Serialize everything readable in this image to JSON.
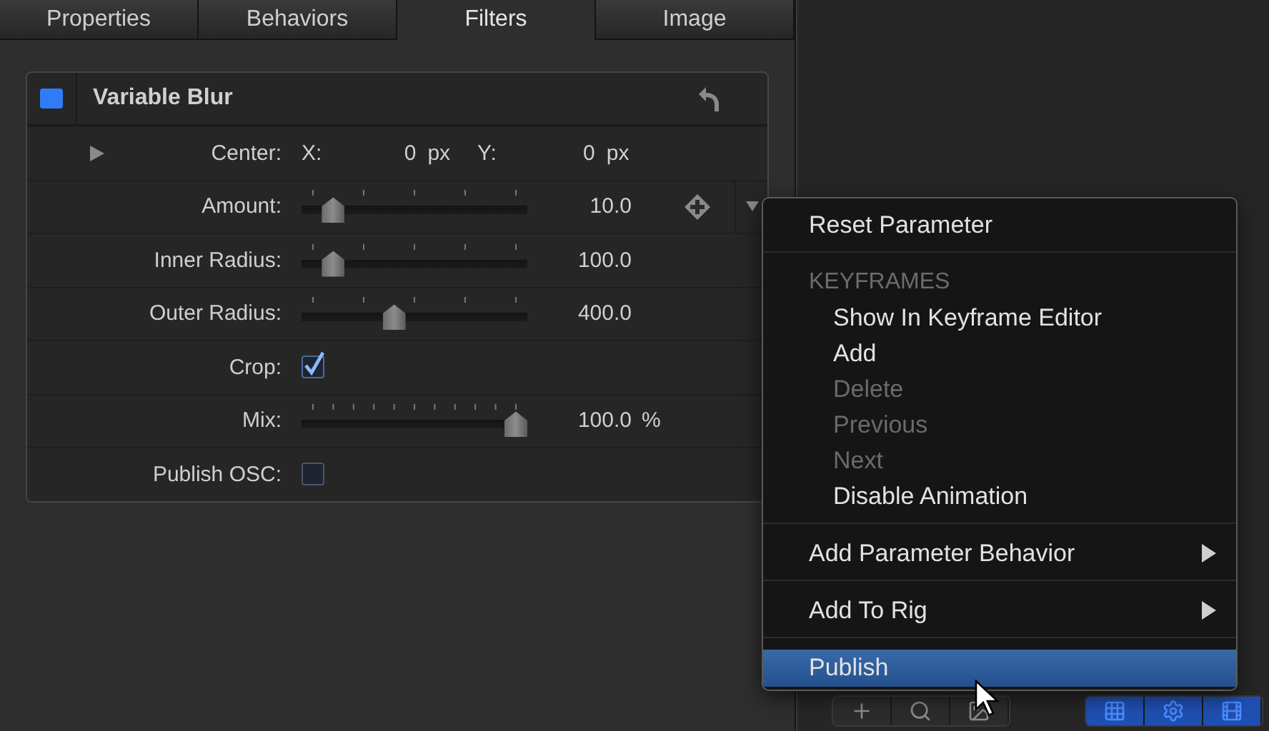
{
  "tabs": [
    {
      "label": "Properties",
      "selected": false
    },
    {
      "label": "Behaviors",
      "selected": false
    },
    {
      "label": "Filters",
      "selected": true
    },
    {
      "label": "Image",
      "selected": false
    }
  ],
  "filter": {
    "title": "Variable Blur",
    "enabled": true,
    "params": [
      {
        "kind": "point",
        "label": "Center:",
        "expanded": false,
        "x_label": "X:",
        "x_value": "0",
        "x_unit": "px",
        "y_label": "Y:",
        "y_value": "0",
        "y_unit": "px"
      },
      {
        "kind": "slider",
        "label": "Amount:",
        "level": 0.1,
        "value": "10.0",
        "animation_menu": true
      },
      {
        "kind": "slider",
        "label": "Inner Radius:",
        "level": 0.1,
        "value": "100.0"
      },
      {
        "kind": "slider",
        "label": "Outer Radius:",
        "level": 0.4,
        "value": "400.0"
      },
      {
        "kind": "checkbox",
        "label": "Crop:",
        "checked": true
      },
      {
        "kind": "fine-slider",
        "label": "Mix:",
        "level": 1,
        "value": "100.0",
        "unit": "%"
      },
      {
        "kind": "checkbox",
        "label": "Publish OSC:",
        "checked": false
      }
    ]
  },
  "context_menu": {
    "groups": [
      {
        "items": [
          {
            "label": "Reset Parameter",
            "disabled": false,
            "submenu": false,
            "selected": false
          }
        ]
      },
      {
        "header": "KEYFRAMES",
        "children": [
          {
            "label": "Show In Keyframe Editor",
            "disabled": false,
            "submenu": false,
            "selected": false
          },
          {
            "label": "Add",
            "disabled": false,
            "submenu": false,
            "selected": false
          },
          {
            "label": "Delete",
            "disabled": true,
            "submenu": false,
            "selected": false
          },
          {
            "label": "Previous",
            "disabled": true,
            "submenu": false,
            "selected": false
          },
          {
            "label": "Next",
            "disabled": true,
            "submenu": false,
            "selected": false
          },
          {
            "label": "Disable Animation",
            "disabled": false,
            "submenu": false,
            "selected": false
          }
        ]
      },
      {
        "items": [
          {
            "label": "Add Parameter Behavior",
            "disabled": false,
            "submenu": true,
            "selected": false
          }
        ]
      },
      {
        "items": [
          {
            "label": "Add To Rig",
            "disabled": false,
            "submenu": true,
            "selected": false
          }
        ]
      },
      {
        "items": [
          {
            "label": "Publish",
            "disabled": false,
            "submenu": false,
            "selected": true
          }
        ]
      }
    ]
  }
}
